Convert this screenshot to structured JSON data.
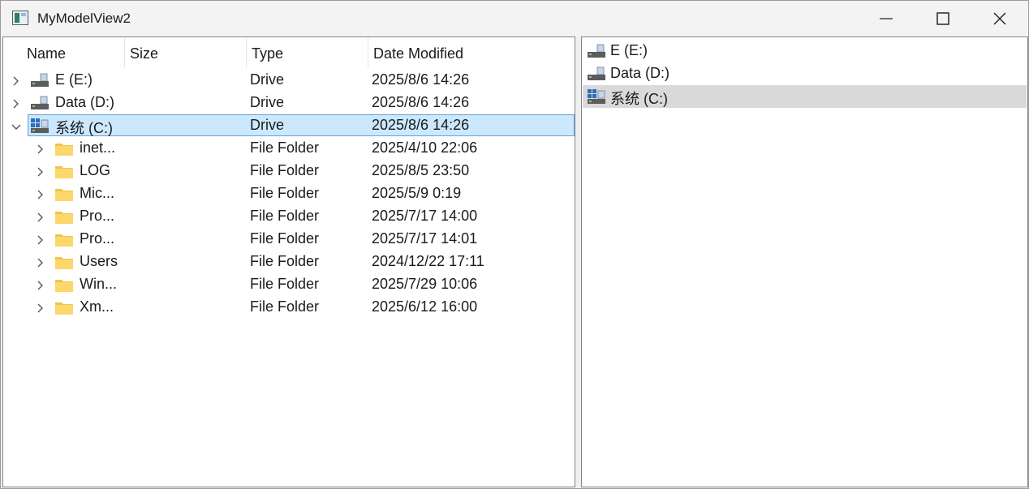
{
  "window": {
    "title": "MyModelView2"
  },
  "columns": {
    "name": "Name",
    "size": "Size",
    "type": "Type",
    "date": "Date Modified"
  },
  "tree_rows": [
    {
      "name": "E (E:)",
      "type": "Drive",
      "date": "2025/8/6 14:26",
      "icon": "drive-icon",
      "expanded": false,
      "level": 0
    },
    {
      "name": "Data (D:)",
      "type": "Drive",
      "date": "2025/8/6 14:26",
      "icon": "drive-icon",
      "expanded": false,
      "level": 0
    },
    {
      "name": "系统 (C:)",
      "type": "Drive",
      "date": "2025/8/6 14:26",
      "icon": "windows-drive-icon",
      "expanded": true,
      "level": 0,
      "selected": true
    },
    {
      "name": "inet...",
      "type": "File Folder",
      "date": "2025/4/10 22:06",
      "icon": "folder-icon",
      "expanded": false,
      "level": 1
    },
    {
      "name": "LOG",
      "type": "File Folder",
      "date": "2025/8/5 23:50",
      "icon": "folder-icon",
      "expanded": false,
      "level": 1
    },
    {
      "name": "Mic...",
      "type": "File Folder",
      "date": "2025/5/9 0:19",
      "icon": "folder-icon",
      "expanded": false,
      "level": 1
    },
    {
      "name": "Pro...",
      "type": "File Folder",
      "date": "2025/7/17 14:00",
      "icon": "folder-icon",
      "expanded": false,
      "level": 1
    },
    {
      "name": "Pro...",
      "type": "File Folder",
      "date": "2025/7/17 14:01",
      "icon": "folder-icon",
      "expanded": false,
      "level": 1
    },
    {
      "name": "Users",
      "type": "File Folder",
      "date": "2024/12/22 17:11",
      "icon": "folder-icon",
      "expanded": false,
      "level": 1
    },
    {
      "name": "Win...",
      "type": "File Folder",
      "date": "2025/7/29 10:06",
      "icon": "folder-icon",
      "expanded": false,
      "level": 1
    },
    {
      "name": "Xm...",
      "type": "File Folder",
      "date": "2025/6/12 16:00",
      "icon": "folder-icon",
      "expanded": false,
      "level": 1
    }
  ],
  "list_items": [
    {
      "name": "E (E:)",
      "icon": "drive-icon"
    },
    {
      "name": "Data (D:)",
      "icon": "drive-icon"
    },
    {
      "name": "系统 (C:)",
      "icon": "windows-drive-icon",
      "selected": true
    }
  ],
  "colors": {
    "selection": "#cce8ff",
    "selection_border": "#6a9fd0",
    "list_selection": "#d9d9d9",
    "folder": "#f8d775"
  }
}
